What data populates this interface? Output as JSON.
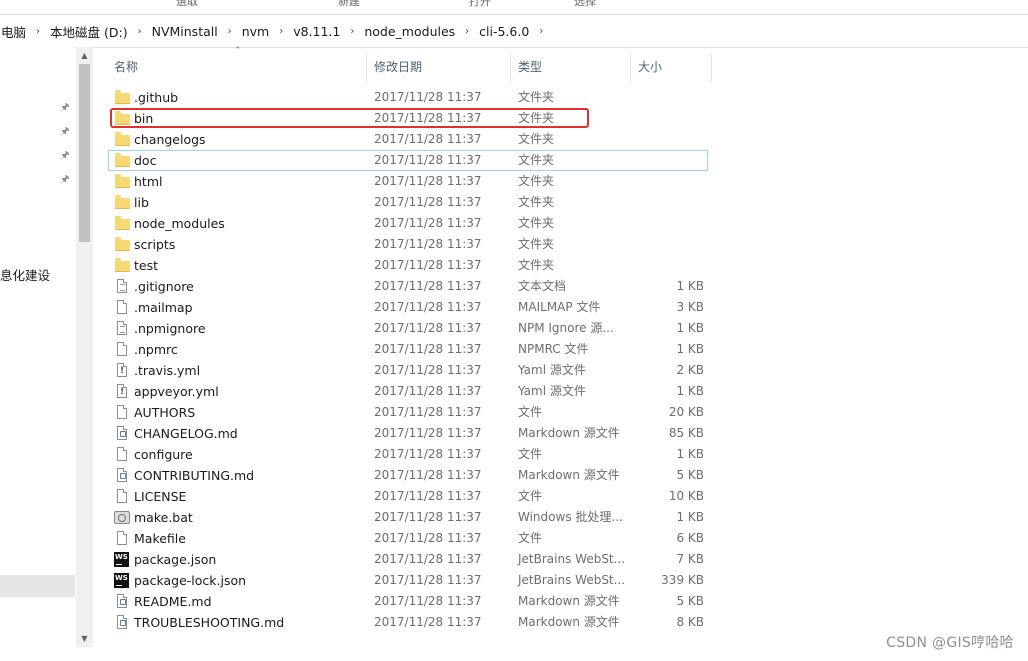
{
  "ribbon": {
    "labels": [
      "選取",
      "新建",
      "打开",
      "选择"
    ]
  },
  "address": {
    "crumbs": [
      "电脑",
      "本地磁盘 (D:)",
      "NVMinstall",
      "nvm",
      "v8.11.1",
      "node_modules",
      "cli-5.6.0"
    ],
    "separator": "›"
  },
  "nav": {
    "partial_label": "息化建设"
  },
  "columns": {
    "name": "名称",
    "date": "修改日期",
    "type": "类型",
    "size": "大小"
  },
  "files": [
    {
      "name": ".github",
      "date": "2017/11/28 11:37",
      "type": "文件夹",
      "size": "",
      "icon": "folder-icon"
    },
    {
      "name": "bin",
      "date": "2017/11/28 11:37",
      "type": "文件夹",
      "size": "",
      "icon": "folder-icon"
    },
    {
      "name": "changelogs",
      "date": "2017/11/28 11:37",
      "type": "文件夹",
      "size": "",
      "icon": "folder-icon"
    },
    {
      "name": "doc",
      "date": "2017/11/28 11:37",
      "type": "文件夹",
      "size": "",
      "icon": "folder-icon"
    },
    {
      "name": "html",
      "date": "2017/11/28 11:37",
      "type": "文件夹",
      "size": "",
      "icon": "folder-icon"
    },
    {
      "name": "lib",
      "date": "2017/11/28 11:37",
      "type": "文件夹",
      "size": "",
      "icon": "folder-icon"
    },
    {
      "name": "node_modules",
      "date": "2017/11/28 11:37",
      "type": "文件夹",
      "size": "",
      "icon": "folder-icon"
    },
    {
      "name": "scripts",
      "date": "2017/11/28 11:37",
      "type": "文件夹",
      "size": "",
      "icon": "folder-icon"
    },
    {
      "name": "test",
      "date": "2017/11/28 11:37",
      "type": "文件夹",
      "size": "",
      "icon": "folder-icon"
    },
    {
      "name": ".gitignore",
      "date": "2017/11/28 11:37",
      "type": "文本文档",
      "size": "1 KB",
      "icon": "text-file-icon"
    },
    {
      "name": ".mailmap",
      "date": "2017/11/28 11:37",
      "type": "MAILMAP 文件",
      "size": "3 KB",
      "icon": "file-icon"
    },
    {
      "name": ".npmignore",
      "date": "2017/11/28 11:37",
      "type": "NPM Ignore 源...",
      "size": "1 KB",
      "icon": "text-file-icon"
    },
    {
      "name": ".npmrc",
      "date": "2017/11/28 11:37",
      "type": "NPMRC 文件",
      "size": "1 KB",
      "icon": "file-icon"
    },
    {
      "name": ".travis.yml",
      "date": "2017/11/28 11:37",
      "type": "Yaml 源文件",
      "size": "2 KB",
      "icon": "yaml-file-icon"
    },
    {
      "name": "appveyor.yml",
      "date": "2017/11/28 11:37",
      "type": "Yaml 源文件",
      "size": "1 KB",
      "icon": "yaml-file-icon"
    },
    {
      "name": "AUTHORS",
      "date": "2017/11/28 11:37",
      "type": "文件",
      "size": "20 KB",
      "icon": "file-icon"
    },
    {
      "name": "CHANGELOG.md",
      "date": "2017/11/28 11:37",
      "type": "Markdown 源文件",
      "size": "85 KB",
      "icon": "markdown-file-icon"
    },
    {
      "name": "configure",
      "date": "2017/11/28 11:37",
      "type": "文件",
      "size": "1 KB",
      "icon": "file-icon"
    },
    {
      "name": "CONTRIBUTING.md",
      "date": "2017/11/28 11:37",
      "type": "Markdown 源文件",
      "size": "5 KB",
      "icon": "markdown-file-icon"
    },
    {
      "name": "LICENSE",
      "date": "2017/11/28 11:37",
      "type": "文件",
      "size": "10 KB",
      "icon": "file-icon"
    },
    {
      "name": "make.bat",
      "date": "2017/11/28 11:37",
      "type": "Windows 批处理...",
      "size": "1 KB",
      "icon": "batch-file-icon"
    },
    {
      "name": "Makefile",
      "date": "2017/11/28 11:37",
      "type": "文件",
      "size": "6 KB",
      "icon": "file-icon"
    },
    {
      "name": "package.json",
      "date": "2017/11/28 11:37",
      "type": "JetBrains WebSt...",
      "size": "7 KB",
      "icon": "webstorm-file-icon"
    },
    {
      "name": "package-lock.json",
      "date": "2017/11/28 11:37",
      "type": "JetBrains WebSt...",
      "size": "339 KB",
      "icon": "webstorm-file-icon"
    },
    {
      "name": "README.md",
      "date": "2017/11/28 11:37",
      "type": "Markdown 源文件",
      "size": "5 KB",
      "icon": "markdown-file-icon"
    },
    {
      "name": "TROUBLESHOOTING.md",
      "date": "2017/11/28 11:37",
      "type": "Markdown 源文件",
      "size": "8 KB",
      "icon": "markdown-file-icon"
    }
  ],
  "watermark": "CSDN @GIS哼哈哈",
  "colors": {
    "highlight": "#e0312f",
    "focus": "#99d1ff",
    "folder": "#f8d775",
    "header_text": "#4c607a"
  }
}
